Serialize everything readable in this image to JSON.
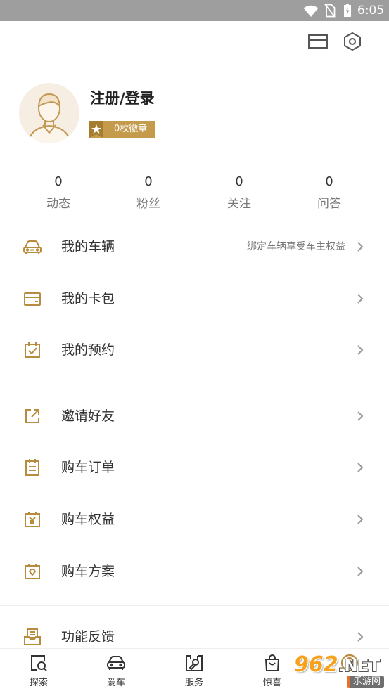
{
  "status_bar": {
    "time": "6:05",
    "icons": [
      "wifi-icon",
      "no-sim-icon",
      "battery-charging-icon"
    ]
  },
  "header": {
    "icons": [
      "card-package-icon",
      "settings-icon"
    ]
  },
  "profile": {
    "avatar_icon": "avatar-person-icon",
    "login_label": "注册/登录",
    "badge_icon": "star-icon",
    "badge_label": "0枚徽章"
  },
  "stats": [
    {
      "value": "0",
      "label": "动态"
    },
    {
      "value": "0",
      "label": "粉丝"
    },
    {
      "value": "0",
      "label": "关注"
    },
    {
      "value": "0",
      "label": "问答"
    }
  ],
  "menu": {
    "items": [
      {
        "icon": "car-icon",
        "label": "我的车辆",
        "hint": "绑定车辆享受车主权益"
      },
      {
        "icon": "card-icon",
        "label": "我的卡包"
      },
      {
        "icon": "calendar-check-icon",
        "label": "我的预约"
      },
      {
        "icon": "share-icon",
        "label": "邀请好友"
      },
      {
        "icon": "order-document-icon",
        "label": "购车订单"
      },
      {
        "icon": "calendar-yen-icon",
        "label": "购车权益"
      },
      {
        "icon": "calendar-diamond-icon",
        "label": "购车方案"
      },
      {
        "icon": "feedback-icon",
        "label": "功能反馈"
      }
    ]
  },
  "bottom_nav": [
    {
      "icon": "explore-icon",
      "label": "探索"
    },
    {
      "icon": "car-front-icon",
      "label": "爱车"
    },
    {
      "icon": "service-wrench-icon",
      "label": "服务"
    },
    {
      "icon": "shopping-bag-icon",
      "label": "惊喜"
    },
    {
      "icon": "user-circle-icon"
    }
  ],
  "watermark": {
    "brand_number": "962",
    "brand_suffix": ".NET",
    "site_name": "乐游网"
  },
  "colors": {
    "accent": "#b88c3e",
    "badge": "#c49a4b",
    "statusbar": "#9e9e9e",
    "text": "#333333",
    "muted": "#777777",
    "divider": "#ececec"
  }
}
